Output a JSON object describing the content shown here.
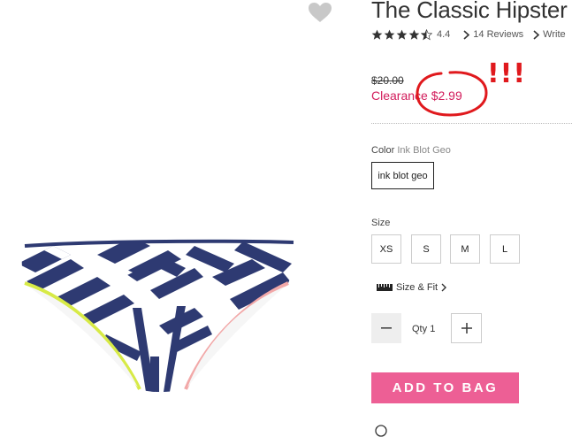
{
  "product": {
    "title": "The Classic Hipster",
    "rating": 4.4,
    "rating_label": "4.4",
    "reviews_link": "14 Reviews",
    "write_link": "Write",
    "old_price": "$20.00",
    "clearance_label": "Clearance",
    "clearance_price": "$2.99",
    "annotation_marks": "!!!"
  },
  "color": {
    "label": "Color",
    "value": "Ink Blot Geo",
    "swatch_label": "ink blot geo"
  },
  "size": {
    "label": "Size",
    "options": [
      "XS",
      "S",
      "M",
      "L"
    ],
    "fit_link": "Size & Fit"
  },
  "quantity": {
    "label": "Qty",
    "value": "1"
  },
  "cta": {
    "add_to_bag": "ADD TO BAG"
  },
  "icons": {
    "heart": "heart-icon",
    "star": "star-icon",
    "ruler": "ruler-icon",
    "minus": "minus-icon",
    "plus": "plus-icon"
  },
  "colors": {
    "accent": "#ed5f95",
    "clearance": "#d21c5b",
    "annotation": "#e0191d",
    "navy": "#2e3a72",
    "lime": "#d7ea46",
    "pink_trim": "#f2a8a8"
  }
}
